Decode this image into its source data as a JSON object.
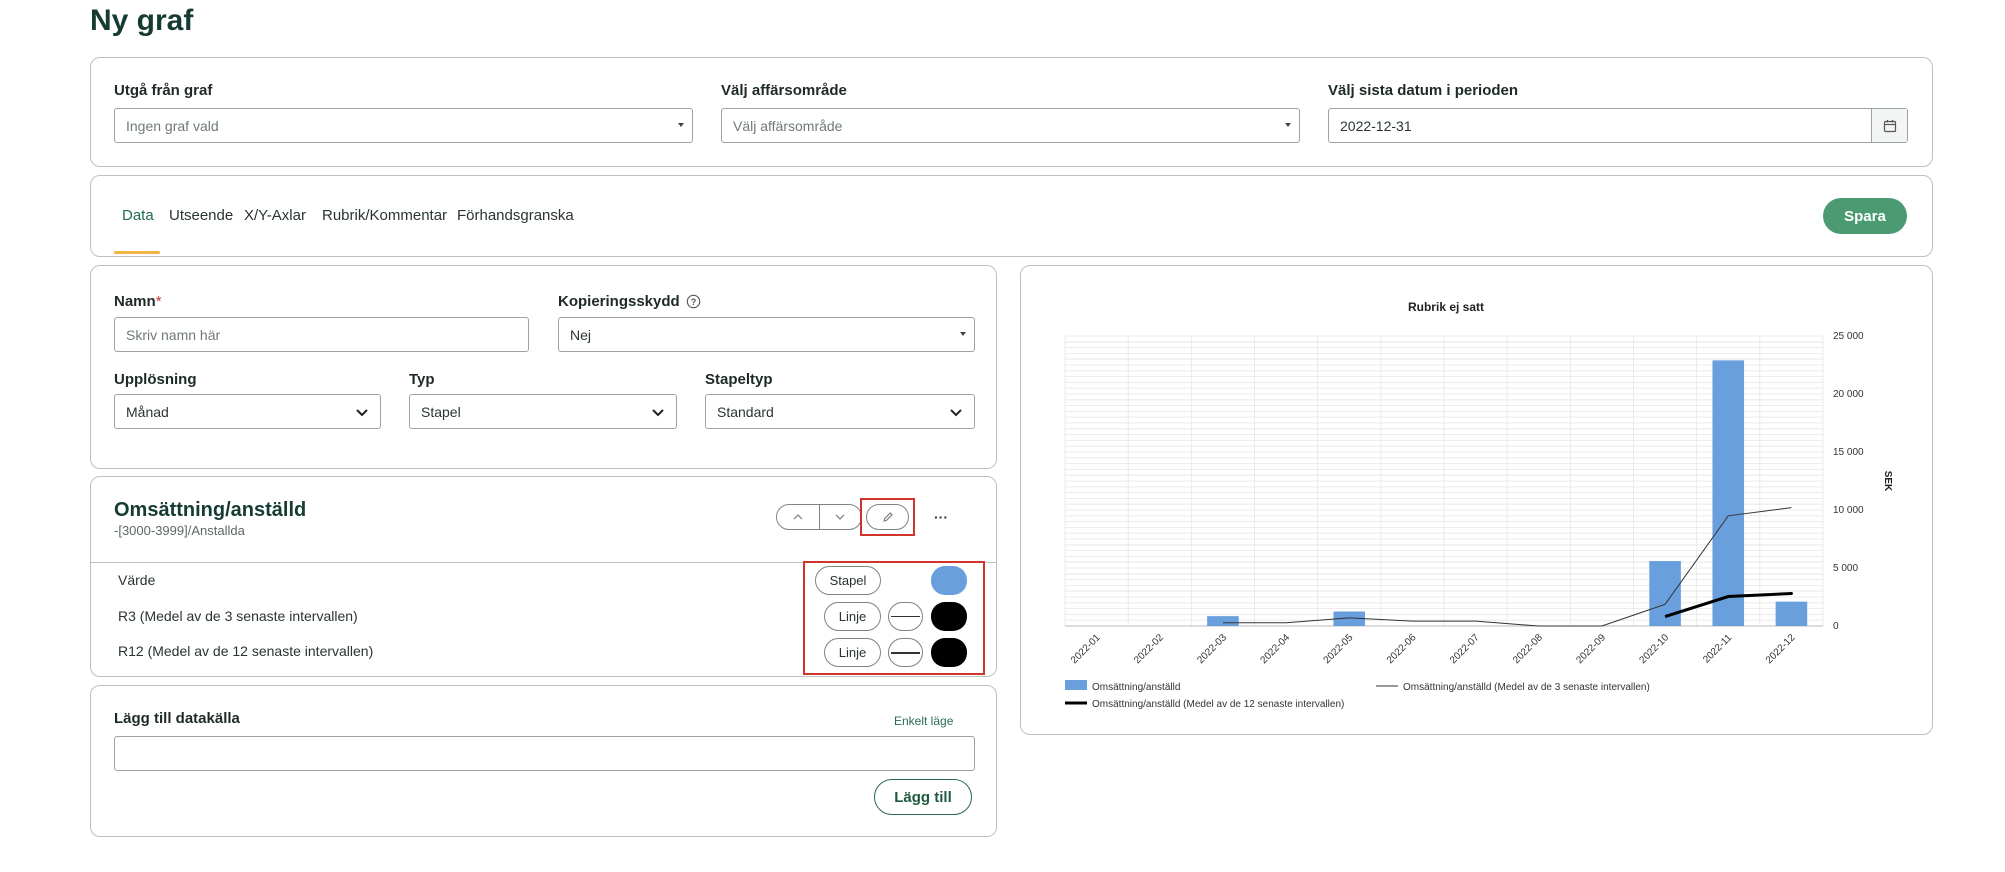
{
  "page": {
    "title": "Ny graf"
  },
  "filters": {
    "base_graph": {
      "label": "Utgå från graf",
      "value": "Ingen graf vald"
    },
    "business_area": {
      "label": "Välj affärsområde",
      "value": "Välj affärsområde"
    },
    "last_date": {
      "label": "Välj sista datum i perioden",
      "value": "2022-12-31"
    }
  },
  "tabs": [
    {
      "label": "Data",
      "active": true
    },
    {
      "label": "Utseende"
    },
    {
      "label": "X/Y-Axlar"
    },
    {
      "label": "Rubrik/Kommentar"
    },
    {
      "label": "Förhandsgranska"
    }
  ],
  "save_button": "Spara",
  "form": {
    "name": {
      "label": "Namn",
      "required_mark": "*",
      "placeholder": "Skriv namn här"
    },
    "copy_protection": {
      "label": "Kopieringsskydd",
      "help_icon": "question-circle-icon",
      "value": "Nej"
    },
    "resolution": {
      "label": "Upplösning",
      "value": "Månad"
    },
    "type": {
      "label": "Typ",
      "value": "Stapel"
    },
    "bar_type": {
      "label": "Stapeltyp",
      "value": "Standard"
    }
  },
  "datasource": {
    "title": "Omsättning/anställd",
    "subtitle": "-[3000-3999]/Anstallda",
    "rows": [
      {
        "label": "Värde",
        "kind": "Stapel",
        "color": "#6a9fde"
      },
      {
        "label": "R3 (Medel av de 3 senaste intervallen)",
        "kind": "Linje",
        "color": "#000000"
      },
      {
        "label": "R12 (Medel av de 12 senaste intervallen)",
        "kind": "Linje",
        "color": "#000000"
      }
    ]
  },
  "add_source": {
    "label": "Lägg till datakälla",
    "mode_link": "Enkelt läge",
    "button": "Lägg till"
  },
  "chart_data": {
    "type": "bar",
    "title": "Rubrik ej satt",
    "ylabel": "SEK",
    "xlabel": "",
    "ylim": [
      0,
      25000
    ],
    "yticks": [
      "0",
      "5 000",
      "10 000",
      "15 000",
      "20 000",
      "25 000"
    ],
    "grid": true,
    "legend_position": "bottom",
    "categories": [
      "2022-01",
      "2022-02",
      "2022-03",
      "2022-04",
      "2022-05",
      "2022-06",
      "2022-07",
      "2022-08",
      "2022-09",
      "2022-10",
      "2022-11",
      "2022-12"
    ],
    "series": [
      {
        "name": "Omsättning/anställd",
        "kind": "bar",
        "color": "#6a9fde",
        "values": [
          0,
          0,
          850,
          0,
          1250,
          0,
          0,
          0,
          0,
          5600,
          22900,
          2100
        ]
      },
      {
        "name": "Omsättning/anställd (Medel av de 3 senaste intervallen)",
        "kind": "line",
        "color": "#333333",
        "width": 1,
        "values": [
          null,
          null,
          283,
          283,
          700,
          417,
          417,
          0,
          0,
          1870,
          9500,
          10200
        ]
      },
      {
        "name": "Omsättning/anställd (Medel av de 12 senaste intervallen)",
        "kind": "line",
        "color": "#000000",
        "width": 3,
        "values": [
          null,
          null,
          null,
          null,
          null,
          null,
          null,
          null,
          null,
          null,
          null,
          2800
        ]
      }
    ]
  }
}
